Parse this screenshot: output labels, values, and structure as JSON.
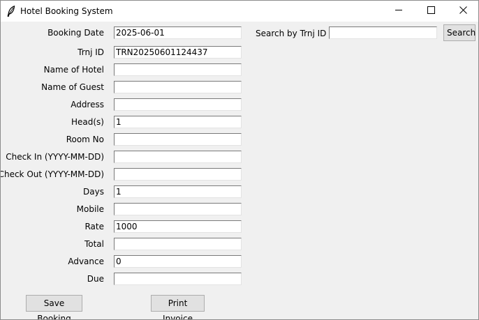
{
  "window": {
    "title": "Hotel Booking System",
    "icon": "feather-icon",
    "controls": [
      "minimize-icon",
      "maximize-icon",
      "close-icon"
    ]
  },
  "form": {
    "fields": [
      {
        "label": "Booking Date",
        "value": "2025-06-01"
      },
      {
        "label": "Trnj ID",
        "value": "TRN20250601124437"
      },
      {
        "label": "Name of Hotel",
        "value": ""
      },
      {
        "label": "Name of Guest",
        "value": ""
      },
      {
        "label": "Address",
        "value": ""
      },
      {
        "label": "Head(s)",
        "value": "1"
      },
      {
        "label": "Room No",
        "value": ""
      },
      {
        "label": "Check In (YYYY-MM-DD)",
        "value": ""
      },
      {
        "label": "Check Out (YYYY-MM-DD)",
        "value": ""
      },
      {
        "label": "Days",
        "value": "1"
      },
      {
        "label": "Mobile",
        "value": ""
      },
      {
        "label": "Rate",
        "value": "1000"
      },
      {
        "label": "Total",
        "value": ""
      },
      {
        "label": "Advance",
        "value": "0"
      },
      {
        "label": "Due",
        "value": ""
      }
    ]
  },
  "search": {
    "label": "Search by Trnj ID",
    "value": "",
    "button_label": "Search"
  },
  "actions": {
    "save_label": "Save Booking",
    "print_label": "Print Invoice"
  }
}
